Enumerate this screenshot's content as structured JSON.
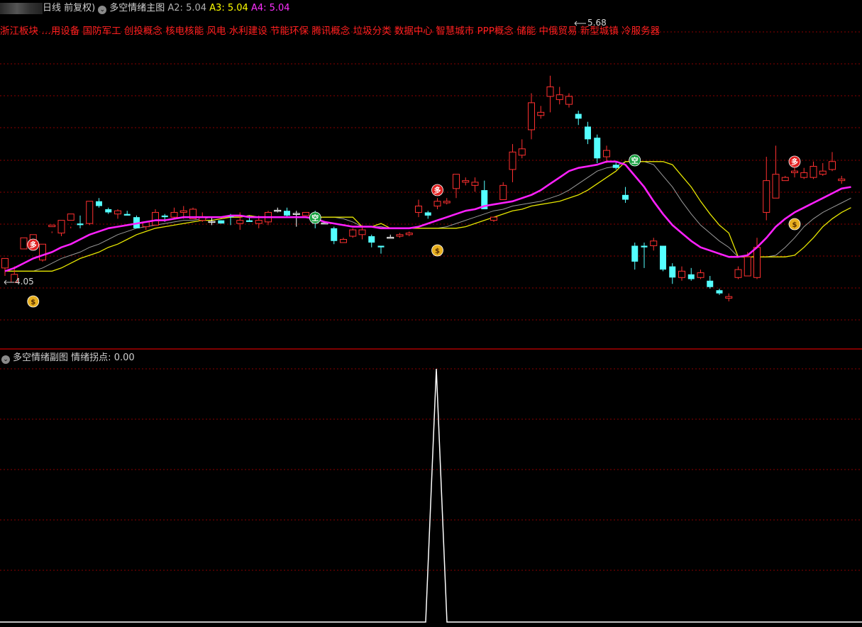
{
  "header": {
    "period_label": "日线 前复权)",
    "indicator_name": "多空情绪主图",
    "a2_label": "A2:",
    "a2_value": "5.04",
    "a3_label": "A3:",
    "a3_value": "5.04",
    "a4_label": "A4:",
    "a4_value": "5.04",
    "colors": {
      "a2": "#b0b0b0",
      "a3": "#ffff00",
      "a4": "#ff30ff"
    }
  },
  "concepts_text": "浙江板块 …用设备 国防军工 创投概念 核电核能 风电 水利建设 节能环保 腾讯概念 垃圾分类 数据中心 智慧城市 PPP概念 储能 中俄贸易 新型城镇 冷服务器",
  "price_labels": {
    "high": "5.68",
    "low": "4.05"
  },
  "signals": {
    "long": "多",
    "short": "空",
    "money": "$"
  },
  "sub_header": {
    "indicator_name": "多空情绪副图",
    "line_label": "情绪拐点:",
    "line_value": "0.00"
  },
  "colors": {
    "up": "#ff3030",
    "down": "#54ffff",
    "ma_main": "#ff20ff",
    "ma_yellow": "#e6e600",
    "ma_gray": "#9a9a9a",
    "grid": "#8b0000",
    "long_signal": "#e02020",
    "short_signal": "#18a040",
    "money": "#e8b020"
  },
  "chart_data": {
    "type": "candlestick",
    "y_range": [
      4.05,
      5.68
    ],
    "candles": [
      [
        4.14,
        4.2,
        4.09,
        4.2
      ],
      [
        4.05,
        4.1,
        4.05,
        4.15
      ],
      [
        4.26,
        4.33,
        4.27,
        4.3
      ],
      [
        4.28,
        4.35,
        4.25,
        4.3
      ],
      [
        4.19,
        4.29,
        4.18,
        4.29
      ],
      [
        4.4,
        4.41,
        4.36,
        4.37
      ],
      [
        4.36,
        4.44,
        4.34,
        4.43
      ],
      [
        4.44,
        4.48,
        4.4,
        4.39
      ],
      [
        4.42,
        4.41,
        4.39,
        4.47
      ],
      [
        4.42,
        4.56,
        4.41,
        4.56
      ],
      [
        4.56,
        4.53,
        4.52,
        4.58
      ],
      [
        4.51,
        4.49,
        4.48,
        4.52
      ],
      [
        4.48,
        4.5,
        4.45,
        4.51
      ],
      [
        4.48,
        4.47,
        4.47,
        4.5
      ],
      [
        4.46,
        4.39,
        4.39,
        4.47
      ],
      [
        4.4,
        4.43,
        4.38,
        4.43
      ],
      [
        4.41,
        4.49,
        4.41,
        4.51
      ],
      [
        4.47,
        4.46,
        4.43,
        4.48
      ],
      [
        4.46,
        4.49,
        4.45,
        4.52
      ],
      [
        4.49,
        4.5,
        4.45,
        4.53
      ],
      [
        4.45,
        4.51,
        4.45,
        4.52
      ],
      [
        4.44,
        4.46,
        4.43,
        4.49
      ],
      [
        4.43,
        4.43,
        4.41,
        4.46
      ],
      [
        4.44,
        4.42,
        4.42,
        4.44
      ],
      [
        4.47,
        4.46,
        4.41,
        4.48
      ],
      [
        4.42,
        4.44,
        4.38,
        4.49
      ],
      [
        4.44,
        4.43,
        4.43,
        4.47
      ],
      [
        4.42,
        4.44,
        4.39,
        4.47
      ],
      [
        4.43,
        4.49,
        4.41,
        4.5
      ],
      [
        4.5,
        4.5,
        4.49,
        4.52
      ],
      [
        4.5,
        4.47,
        4.46,
        4.52
      ],
      [
        4.48,
        4.48,
        4.4,
        4.5
      ],
      [
        4.47,
        4.49,
        4.47,
        4.49
      ],
      [
        4.47,
        4.42,
        4.39,
        4.5
      ],
      [
        4.42,
        4.42,
        4.42,
        4.42
      ],
      [
        4.39,
        4.31,
        4.29,
        4.4
      ],
      [
        4.3,
        4.32,
        4.3,
        4.33
      ],
      [
        4.34,
        4.38,
        4.33,
        4.39
      ],
      [
        4.35,
        4.38,
        4.32,
        4.41
      ],
      [
        4.34,
        4.3,
        4.27,
        4.35
      ],
      [
        4.28,
        4.27,
        4.23,
        4.28
      ],
      [
        4.33,
        4.33,
        4.33,
        4.35
      ],
      [
        4.34,
        4.35,
        4.33,
        4.36
      ],
      [
        4.35,
        4.36,
        4.34,
        4.37
      ],
      [
        4.49,
        4.53,
        4.46,
        4.57
      ],
      [
        4.49,
        4.47,
        4.45,
        4.5
      ],
      [
        4.53,
        4.56,
        4.51,
        4.58
      ],
      [
        4.55,
        4.56,
        4.54,
        4.58
      ],
      [
        4.64,
        4.73,
        4.58,
        4.73
      ],
      [
        4.68,
        4.69,
        4.66,
        4.71
      ],
      [
        4.66,
        4.68,
        4.62,
        4.71
      ],
      [
        4.63,
        4.51,
        4.51,
        4.69
      ],
      [
        4.44,
        4.46,
        4.43,
        4.46
      ],
      [
        4.57,
        4.66,
        4.57,
        4.68
      ],
      [
        4.76,
        4.87,
        4.68,
        4.92
      ],
      [
        4.85,
        4.89,
        4.83,
        4.95
      ],
      [
        5.01,
        5.18,
        4.95,
        5.24
      ],
      [
        5.1,
        5.12,
        5.08,
        5.16
      ],
      [
        5.22,
        5.28,
        5.12,
        5.35
      ],
      [
        5.2,
        5.23,
        5.17,
        5.28
      ],
      [
        5.17,
        5.22,
        5.15,
        5.24
      ],
      [
        5.11,
        5.08,
        5.04,
        5.13
      ],
      [
        5.03,
        4.95,
        4.92,
        5.06
      ],
      [
        4.96,
        4.83,
        4.8,
        4.98
      ],
      [
        4.84,
        4.88,
        4.8,
        4.91
      ],
      [
        4.79,
        4.77,
        4.76,
        4.81
      ],
      [
        4.6,
        4.57,
        4.55,
        4.65
      ],
      [
        4.28,
        4.18,
        4.13,
        4.3
      ],
      [
        4.28,
        4.27,
        4.14,
        4.3
      ],
      [
        4.28,
        4.31,
        4.25,
        4.33
      ],
      [
        4.28,
        4.13,
        4.12,
        4.28
      ],
      [
        4.15,
        4.08,
        4.04,
        4.17
      ],
      [
        4.08,
        4.12,
        4.06,
        4.15
      ],
      [
        4.1,
        4.07,
        4.06,
        4.14
      ],
      [
        4.08,
        4.11,
        4.07,
        4.13
      ],
      [
        4.06,
        4.02,
        4.01,
        4.09
      ],
      [
        4.0,
        3.98,
        3.97,
        4.01
      ],
      [
        3.95,
        3.96,
        3.93,
        3.98
      ],
      [
        4.08,
        4.13,
        4.07,
        4.15
      ],
      [
        4.09,
        4.21,
        4.09,
        4.24
      ],
      [
        4.08,
        4.27,
        4.07,
        4.33
      ],
      [
        4.49,
        4.69,
        4.44,
        4.84
      ],
      [
        4.58,
        4.73,
        4.58,
        4.91
      ],
      [
        4.69,
        4.71,
        4.69,
        4.72
      ],
      [
        4.74,
        4.75,
        4.71,
        4.79
      ],
      [
        4.71,
        4.74,
        4.7,
        4.77
      ],
      [
        4.71,
        4.78,
        4.7,
        4.81
      ],
      [
        4.73,
        4.75,
        4.72,
        4.8
      ],
      [
        4.76,
        4.81,
        4.75,
        4.87
      ],
      [
        4.69,
        4.7,
        4.67,
        4.72
      ]
    ],
    "ma_main": [
      4.12,
      4.14,
      4.17,
      4.2,
      4.22,
      4.24,
      4.27,
      4.29,
      4.32,
      4.35,
      4.37,
      4.39,
      4.4,
      4.41,
      4.42,
      4.43,
      4.44,
      4.44,
      4.45,
      4.46,
      4.46,
      4.46,
      4.46,
      4.46,
      4.47,
      4.47,
      4.46,
      4.46,
      4.46,
      4.46,
      4.46,
      4.46,
      4.46,
      4.45,
      4.43,
      4.42,
      4.41,
      4.4,
      4.4,
      4.4,
      4.39,
      4.39,
      4.39,
      4.39,
      4.4,
      4.42,
      4.44,
      4.46,
      4.48,
      4.5,
      4.51,
      4.53,
      4.54,
      4.55,
      4.56,
      4.58,
      4.6,
      4.63,
      4.67,
      4.71,
      4.75,
      4.77,
      4.78,
      4.79,
      4.81,
      4.81,
      4.79,
      4.72,
      4.65,
      4.56,
      4.48,
      4.41,
      4.36,
      4.31,
      4.27,
      4.25,
      4.23,
      4.21,
      4.21,
      4.22,
      4.27,
      4.33,
      4.4,
      4.45,
      4.49,
      4.52,
      4.55,
      4.58,
      4.61,
      4.64,
      4.65
    ],
    "sub_series": {
      "name": "情绪拐点",
      "peak_index": 41,
      "peak_value": 1,
      "baseline": 0
    }
  }
}
